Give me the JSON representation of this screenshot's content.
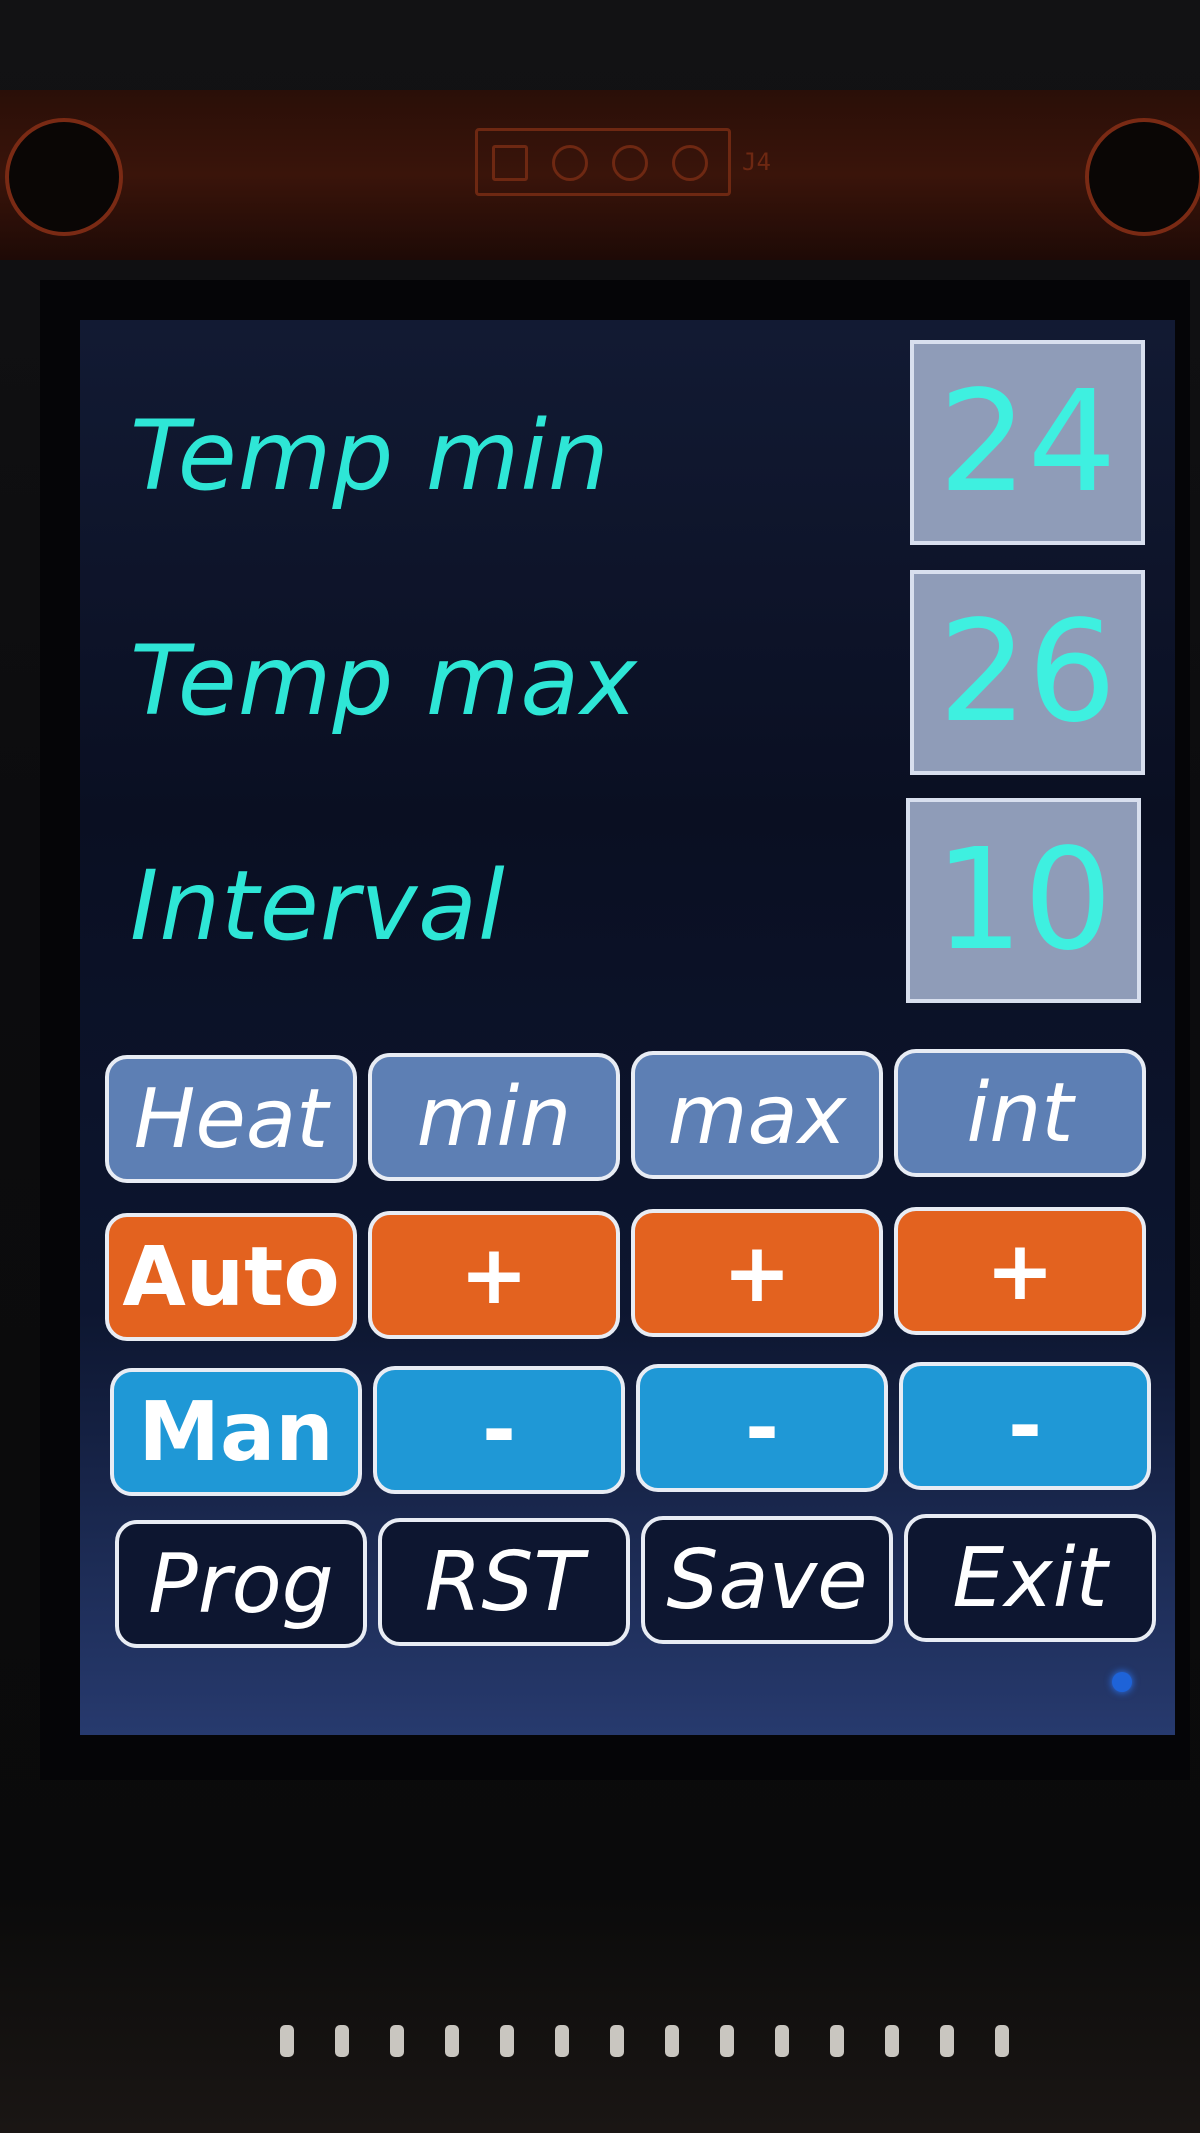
{
  "hardware": {
    "header_label": "J4"
  },
  "settings": {
    "rows": [
      {
        "label": "Temp min",
        "value": "24"
      },
      {
        "label": "Temp max",
        "value": "26"
      },
      {
        "label": "Interval",
        "value": "10"
      }
    ]
  },
  "buttons": {
    "row1": [
      "Heat",
      "min",
      "max",
      "int"
    ],
    "row2": [
      "Auto",
      "+",
      "+",
      "+"
    ],
    "row3": [
      "Man",
      "-",
      "-",
      "-"
    ],
    "row4": [
      "Prog",
      "RST",
      "Save",
      "Exit"
    ]
  },
  "colors": {
    "label_text": "#2ee6d6",
    "value_box": "#8f9cb8",
    "mode_button": "#5d7fb4",
    "plus_button": "#e3621f",
    "minus_button": "#1f98d6",
    "action_button": "#0d1630",
    "status_led": "#1e63d8"
  }
}
